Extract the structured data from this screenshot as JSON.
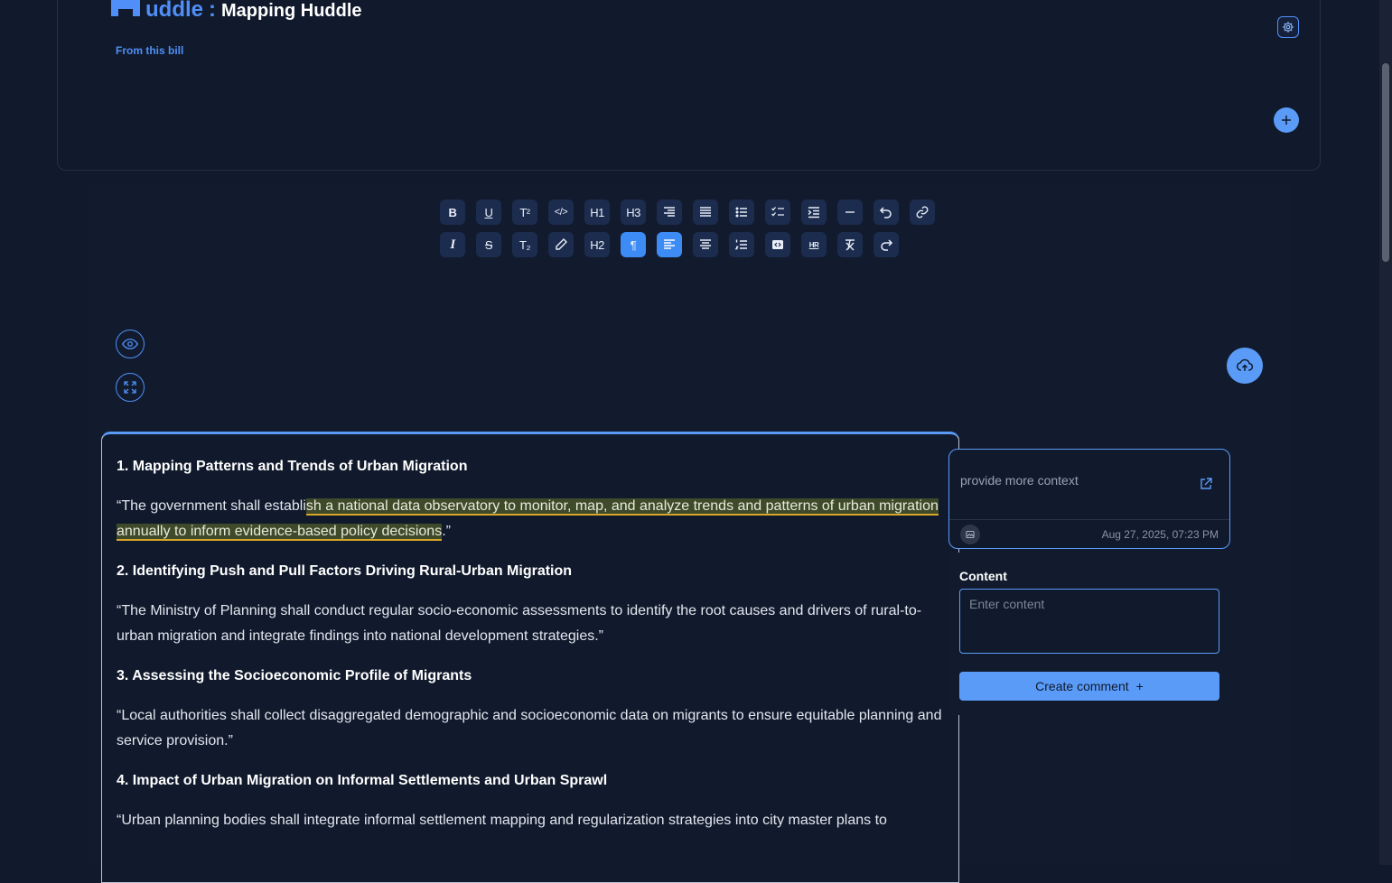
{
  "header": {
    "brand_word": "uddle",
    "brand_separator": ":",
    "title": "Mapping Huddle",
    "subtitle": "From this bill"
  },
  "toolbar": {
    "row1": [
      {
        "name": "bold",
        "glyph": "B"
      },
      {
        "name": "underline",
        "glyph": "U"
      },
      {
        "name": "superscript",
        "glyph": "T²"
      },
      {
        "name": "code",
        "glyph": "</>"
      },
      {
        "name": "heading-1",
        "glyph": "H1"
      },
      {
        "name": "heading-3",
        "glyph": "H3"
      },
      {
        "name": "align-right",
        "glyph": "align-right"
      },
      {
        "name": "align-justify",
        "glyph": "align-justify"
      },
      {
        "name": "bullet-list",
        "glyph": "bullet-list"
      },
      {
        "name": "task-list",
        "glyph": "task-list"
      },
      {
        "name": "indent",
        "glyph": "indent"
      },
      {
        "name": "horizontal-line",
        "glyph": "—"
      },
      {
        "name": "undo",
        "glyph": "undo"
      },
      {
        "name": "link",
        "glyph": "link"
      }
    ],
    "row2": [
      {
        "name": "italic",
        "glyph": "I"
      },
      {
        "name": "strikethrough",
        "glyph": "S"
      },
      {
        "name": "subscript",
        "glyph": "T₂"
      },
      {
        "name": "highlight",
        "glyph": "pen"
      },
      {
        "name": "heading-2",
        "glyph": "H2"
      },
      {
        "name": "paragraph",
        "glyph": "¶",
        "active": true
      },
      {
        "name": "align-left",
        "glyph": "align-left",
        "active": true
      },
      {
        "name": "align-center",
        "glyph": "align-center"
      },
      {
        "name": "ordered-list",
        "glyph": "ordered-list"
      },
      {
        "name": "code-block",
        "glyph": "code-block"
      },
      {
        "name": "hr",
        "glyph": "HR"
      },
      {
        "name": "clear-format",
        "glyph": "clear"
      },
      {
        "name": "redo",
        "glyph": "redo"
      }
    ]
  },
  "document": {
    "s1_heading": "1. Mapping Patterns and Trends of Urban Migration",
    "s1_before": " “The government shall establi",
    "s1_highlight": "sh a national data observatory to monitor, map, and analyze trends and patterns of urban migration annually to inform evidence-based policy decisions",
    "s1_after": ".”",
    "s2_heading": "2. Identifying Push and Pull Factors Driving Rural-Urban Migration",
    "s2_text": " “The Ministry of Planning shall conduct regular socio-economic assessments to identify the root causes and drivers of rural-to-urban migration and integrate findings into national development strategies.”",
    "s3_heading": "3. Assessing the Socioeconomic Profile of Migrants",
    "s3_text": " “Local authorities shall collect disaggregated demographic and socioeconomic data on migrants to ensure equitable planning and service provision.”",
    "s4_heading": "4. Impact of Urban Migration on Informal Settlements and Urban Sprawl",
    "s4_text": " “Urban planning bodies shall integrate informal settlement mapping and regularization strategies into city master plans to"
  },
  "comment": {
    "text": "provide more context",
    "date": "Aug 27, 2025, 07:23 PM"
  },
  "form": {
    "label": "Content",
    "placeholder": "Enter content",
    "submit_label": "Create comment",
    "submit_icon": "+"
  },
  "colors": {
    "accent": "#5b9bf8",
    "background": "#111a2c",
    "highlight_underline": "#d8a628"
  }
}
